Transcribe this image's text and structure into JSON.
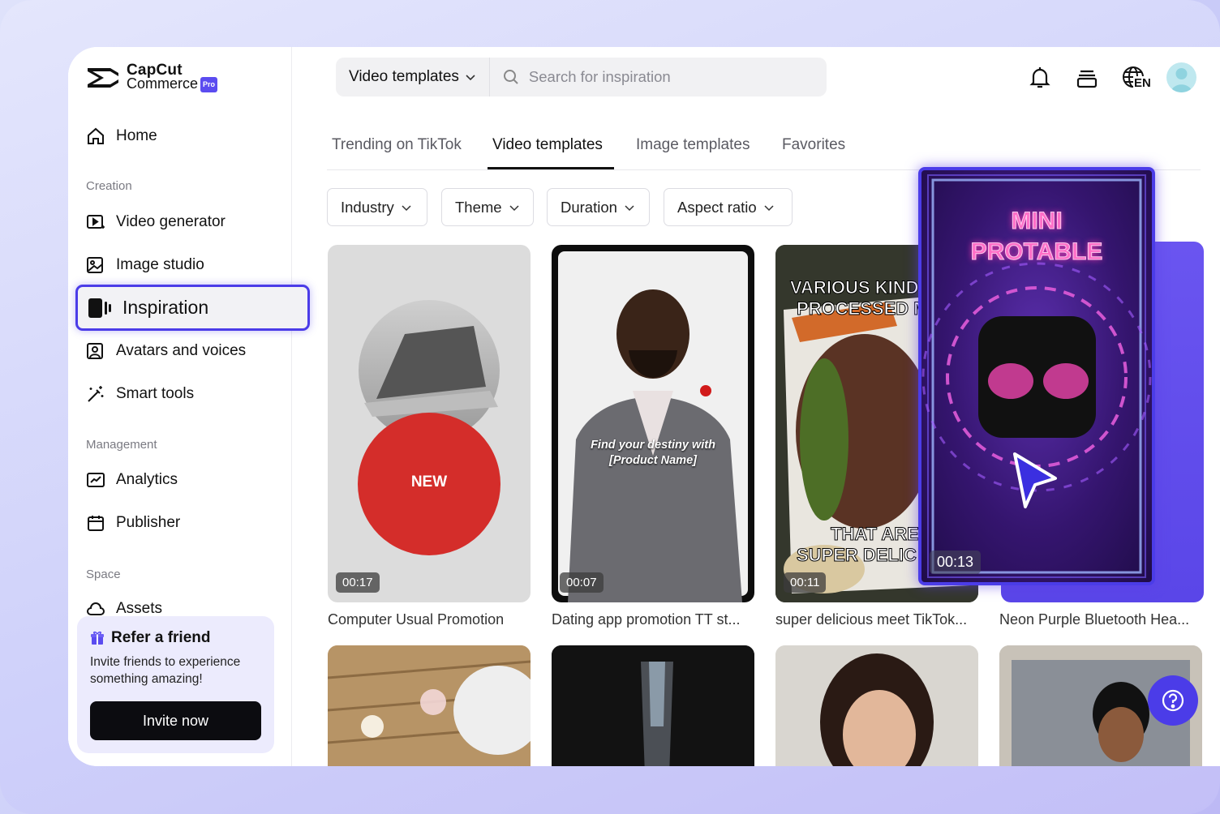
{
  "brand": {
    "line1": "CapCut",
    "line2": "Commerce",
    "badge": "Pro"
  },
  "sidebar": {
    "home": "Home",
    "creation_label": "Creation",
    "video_generator": "Video generator",
    "image_studio": "Image studio",
    "inspiration": "Inspiration",
    "avatars_voices": "Avatars and voices",
    "smart_tools": "Smart tools",
    "management_label": "Management",
    "analytics": "Analytics",
    "publisher": "Publisher",
    "space_label": "Space",
    "assets": "Assets"
  },
  "refer": {
    "title": "Refer a friend",
    "description": "Invite friends to experience something amazing!",
    "button": "Invite now"
  },
  "search": {
    "dropdown": "Video templates",
    "placeholder": "Search for inspiration"
  },
  "header": {
    "language": "EN"
  },
  "tabs": [
    "Trending on TikTok",
    "Video templates",
    "Image templates",
    "Favorites"
  ],
  "filters": [
    "Industry",
    "Theme",
    "Duration",
    "Aspect ratio"
  ],
  "cards": [
    {
      "title": "Computer Usual Promotion",
      "duration": "00:17",
      "overlay": "NEW"
    },
    {
      "title": "Dating app promotion TT st...",
      "duration": "00:07",
      "overlay_line1": "Find your destiny with",
      "overlay_line2": "[Product Name]"
    },
    {
      "title": "super delicious meet TikTok...",
      "duration": "00:11",
      "overlay_top1": "VARIOUS KIND",
      "overlay_top2": "PROCESSED M",
      "overlay_bottom1": "THAT ARE",
      "overlay_bottom2": "SUPER DELIC"
    },
    {
      "title": "Neon Purple Bluetooth Hea...",
      "duration": "00:13",
      "overlay_line1": "MINI",
      "overlay_line2": "PROTABLE"
    }
  ],
  "colors": {
    "accent": "#4b3ce8",
    "text": "#111111",
    "muted": "#7a7a82"
  }
}
